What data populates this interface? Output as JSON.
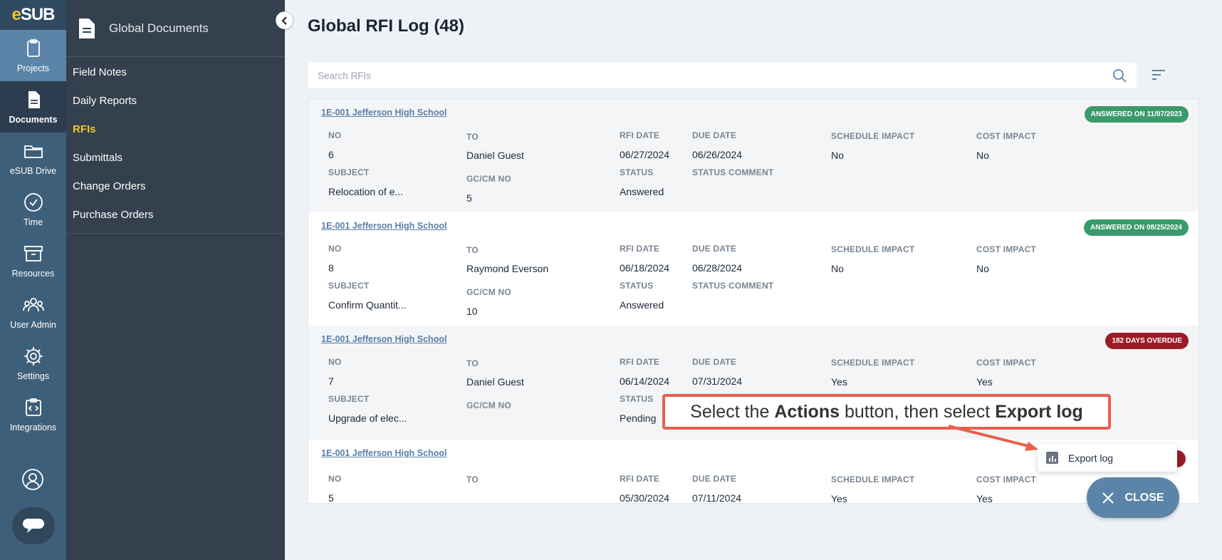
{
  "brand": {
    "logo_e": "e",
    "logo_rest": "SUB"
  },
  "rail": [
    {
      "label": "Projects",
      "icon": "clipboard-icon"
    },
    {
      "label": "Documents",
      "icon": "document-icon"
    },
    {
      "label": "eSUB Drive",
      "icon": "folder-icon"
    },
    {
      "label": "Time",
      "icon": "clock-icon"
    },
    {
      "label": "Resources",
      "icon": "archive-box-icon"
    },
    {
      "label": "User Admin",
      "icon": "users-icon"
    },
    {
      "label": "Settings",
      "icon": "gear-icon"
    },
    {
      "label": "Integrations",
      "icon": "integration-icon"
    }
  ],
  "subnav": {
    "title": "Global Documents",
    "items": [
      "Field Notes",
      "Daily Reports",
      "RFIs",
      "Submittals",
      "Change Orders",
      "Purchase Orders"
    ],
    "active": "RFIs"
  },
  "page": {
    "title": "Global RFI Log (48)"
  },
  "search": {
    "placeholder": "Search RFIs",
    "value": ""
  },
  "labels": {
    "no": "NO",
    "to": "TO",
    "rfi_date": "RFI DATE",
    "due_date": "DUE DATE",
    "schedule_impact": "SCHEDULE IMPACT",
    "cost_impact": "COST IMPACT",
    "subject": "SUBJECT",
    "gc_cm_no": "GC/CM NO",
    "status": "STATUS",
    "status_comment": "STATUS COMMENT"
  },
  "rfis": [
    {
      "project": "1E-001 Jefferson High School",
      "badge": "ANSWERED ON 11/07/2023",
      "badge_color": "#3a9a6a",
      "no": "6",
      "to": "Daniel Guest",
      "rfi_date": "06/27/2024",
      "due_date": "06/26/2024",
      "schedule_impact": "No",
      "cost_impact": "No",
      "subject": "Relocation of e...",
      "gc_cm_no": "5",
      "status": "Answered"
    },
    {
      "project": "1E-001 Jefferson High School",
      "badge": "ANSWERED ON 08/25/2024",
      "badge_color": "#3a9a6a",
      "no": "8",
      "to": "Raymond Everson",
      "rfi_date": "06/18/2024",
      "due_date": "06/28/2024",
      "schedule_impact": "No",
      "cost_impact": "No",
      "subject": "Confirm Quantit...",
      "gc_cm_no": "10",
      "status": "Answered"
    },
    {
      "project": "1E-001 Jefferson High School",
      "badge": "182 DAYS OVERDUE",
      "badge_color": "#9b1c27",
      "no": "7",
      "to": "Daniel Guest",
      "rfi_date": "06/14/2024",
      "due_date": "07/31/2024",
      "schedule_impact": "Yes",
      "cost_impact": "Yes",
      "subject": "Upgrade of elec...",
      "gc_cm_no": "",
      "status": "Pending"
    },
    {
      "project": "1E-001 Jefferson High School",
      "badge": "",
      "badge_color": "#9b1c27",
      "no": "5",
      "to": "",
      "rfi_date": "05/30/2024",
      "due_date": "07/11/2024",
      "schedule_impact": "Yes",
      "cost_impact": "Yes",
      "subject": "",
      "gc_cm_no": "",
      "status": ""
    }
  ],
  "callout": {
    "pre": "Select the ",
    "b1": "Actions",
    "mid": " button, then select ",
    "b2": "Export log"
  },
  "export_menu": {
    "label": "Export log",
    "icon": "chart-icon"
  },
  "close_button": {
    "label": "CLOSE"
  },
  "colors": {
    "accent": "#f4c430",
    "rail": "#3e5f7a",
    "subnav": "#34404d",
    "callout_border": "#e8604c"
  }
}
